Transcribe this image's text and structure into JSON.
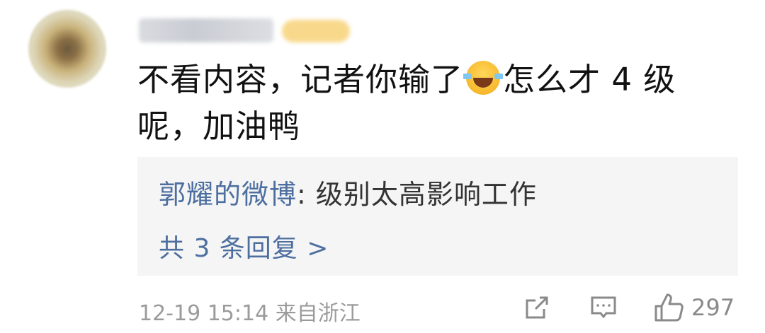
{
  "comment": {
    "line1_part1": "不看内容，记者你输了",
    "emoji": "laughing-tears-emoji",
    "line1_part2": "怎么才 4 级",
    "line2": "呢，加油鸭"
  },
  "reply": {
    "author": "郭耀的微博",
    "separator": ": ",
    "text": "级别太高影响工作",
    "count_label": "共 3 条回复 >"
  },
  "meta": {
    "timestamp": "12-19 15:14",
    "source": "来自浙江"
  },
  "actions": {
    "share_icon": "share-icon",
    "comment_icon": "comment-icon",
    "like_icon": "thumbs-up-icon",
    "like_count": "297"
  },
  "colors": {
    "link": "#4d6fa0",
    "muted": "#9b9b9b",
    "reply_bg": "#f5f5f5"
  }
}
